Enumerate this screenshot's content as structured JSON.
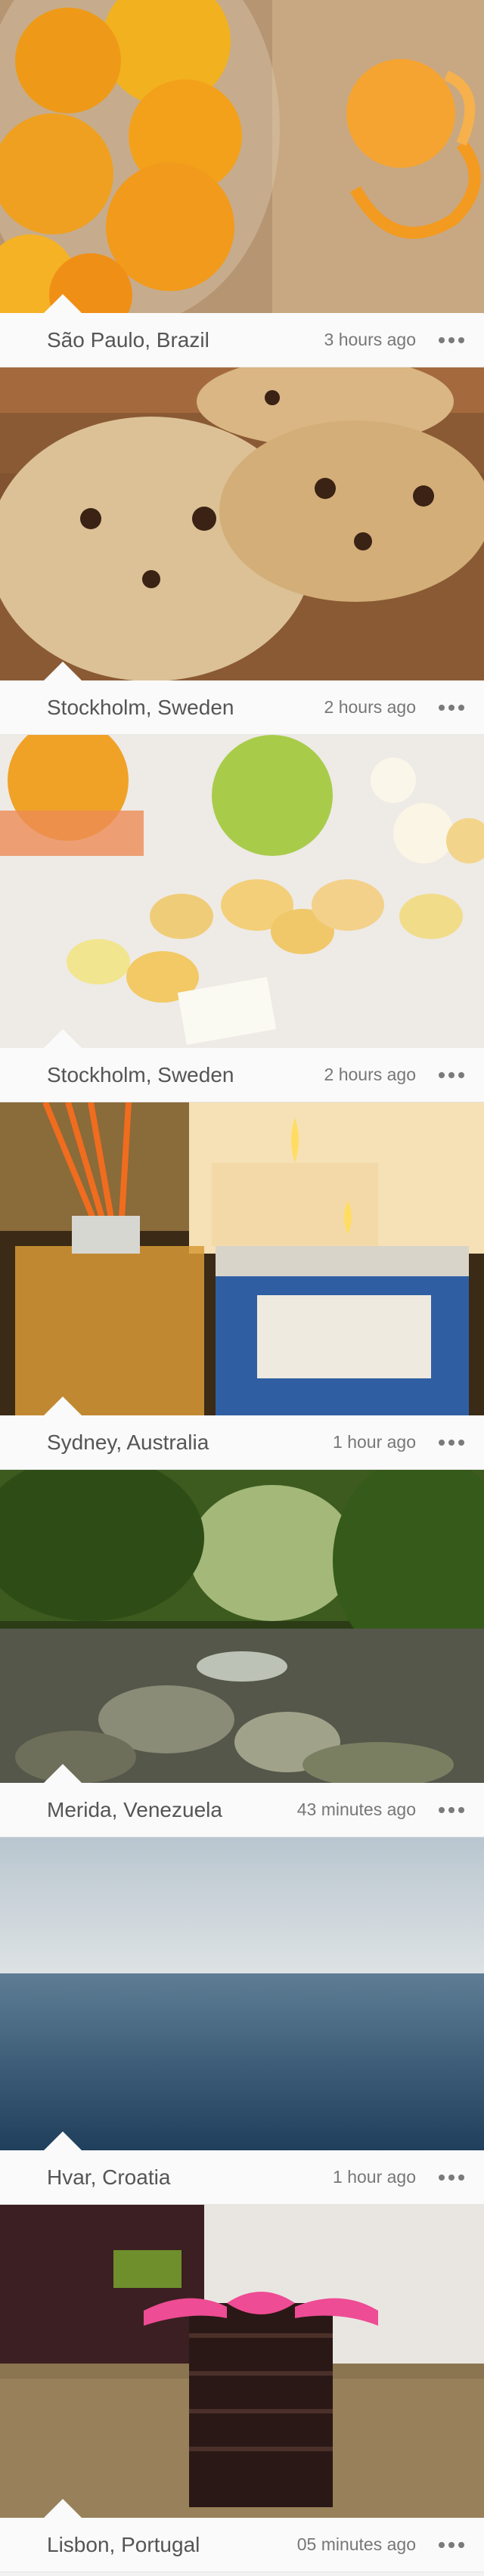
{
  "feed": {
    "posts": [
      {
        "location": "São Paulo, Brazil",
        "time": "3 hours ago",
        "photo_icon": "oranges-photo"
      },
      {
        "location": "Stockholm, Sweden",
        "time": "2 hours ago",
        "photo_icon": "cookies-photo"
      },
      {
        "location": "Stockholm, Sweden",
        "time": "2 hours ago",
        "photo_icon": "candles-photo"
      },
      {
        "location": "Sydney, Australia",
        "time": "1 hour ago",
        "photo_icon": "diffuser-candle-photo"
      },
      {
        "location": "Merida, Venezuela",
        "time": "43 minutes ago",
        "photo_icon": "jungle-stream-photo"
      },
      {
        "location": "Hvar, Croatia",
        "time": "1 hour ago",
        "photo_icon": "sea-horizon-photo"
      },
      {
        "location": "Lisbon, Portugal",
        "time": "05 minutes ago",
        "photo_icon": "chocolate-stack-photo"
      }
    ],
    "more_icon": "more-dots-icon",
    "colors": {
      "background": "#f2f2f2",
      "meta_bar": "#fafafa",
      "location_text": "#555555",
      "time_text": "#777777"
    }
  }
}
